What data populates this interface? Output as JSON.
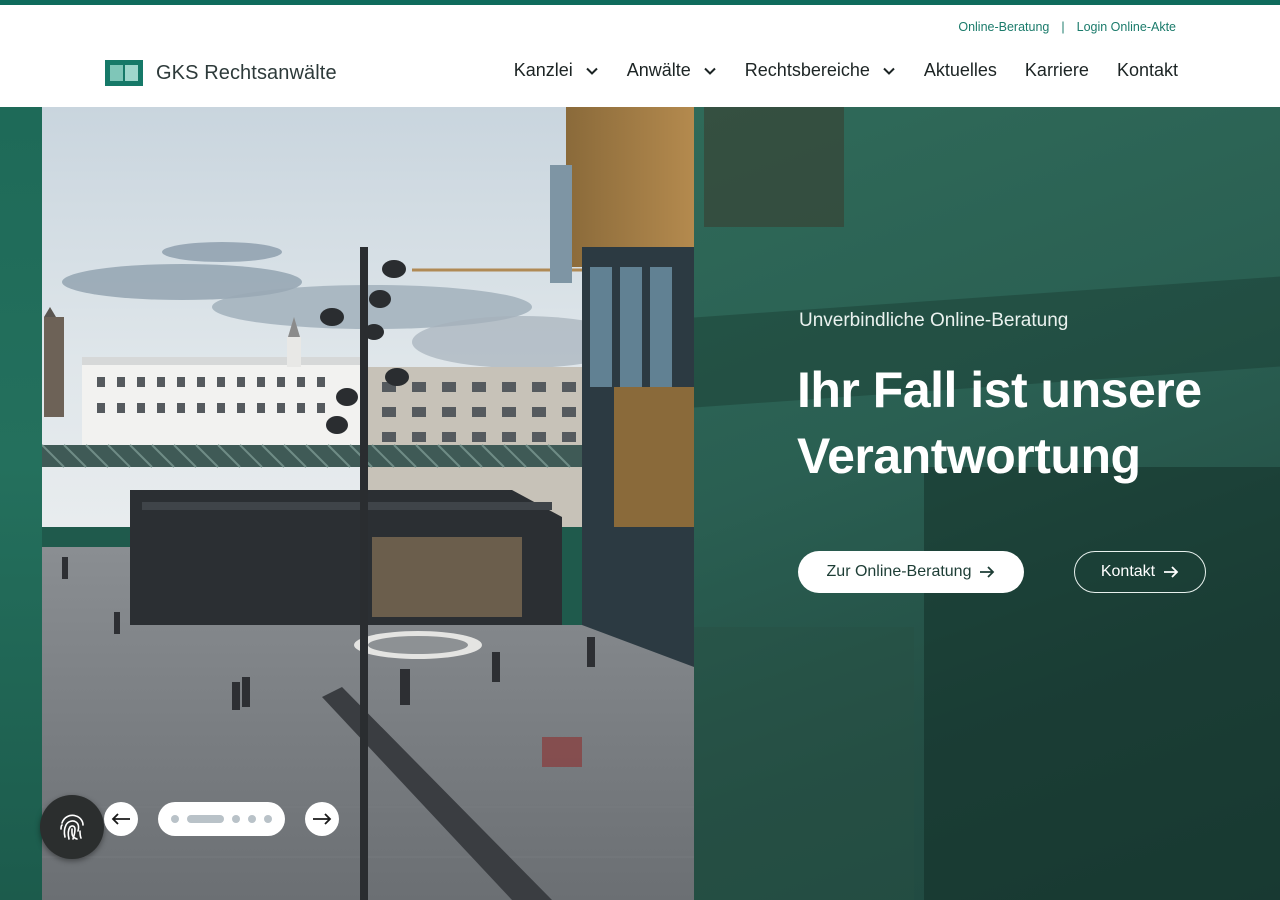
{
  "utility": {
    "online_beratung": "Online-Beratung",
    "separator": "|",
    "login": "Login Online-Akte"
  },
  "brand": {
    "name": "GKS Rechtsanwälte",
    "color": "#167968"
  },
  "nav": {
    "items": [
      {
        "label": "Kanzlei",
        "has_dropdown": true
      },
      {
        "label": "Anwälte",
        "has_dropdown": true
      },
      {
        "label": "Rechtsbereiche",
        "has_dropdown": true
      },
      {
        "label": "Aktuelles",
        "has_dropdown": false
      },
      {
        "label": "Karriere",
        "has_dropdown": false
      },
      {
        "label": "Kontakt",
        "has_dropdown": false
      }
    ]
  },
  "hero": {
    "subtitle": "Unverbindliche Online-Beratung",
    "headline": "Ihr Fall ist unsere Verantwortung",
    "primary_cta": "Zur Online-Beratung",
    "secondary_cta": "Kontakt",
    "accent_color": "#1f5a4c"
  },
  "slider": {
    "total_slides": 5,
    "active_index": 1,
    "prev_icon": "arrow-left-icon",
    "next_icon": "arrow-right-icon"
  },
  "floating": {
    "icon": "fingerprint-icon"
  }
}
